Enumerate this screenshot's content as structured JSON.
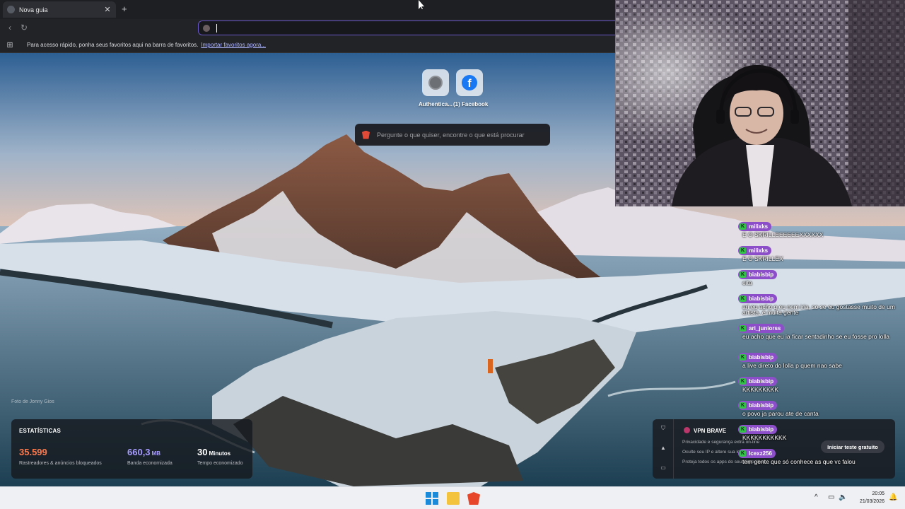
{
  "browser": {
    "tab": {
      "title": "Nova guia",
      "close_icon": "close-icon",
      "new_tab_icon": "plus-icon"
    },
    "toolbar": {
      "back_icon": "chevron-left-icon",
      "reload_icon": "reload-icon",
      "url_value": ""
    },
    "bookmarks": {
      "apps_icon": "apps-grid-icon",
      "hint": "Para acesso rápido, ponha seus favoritos aqui na barra de favoritos.",
      "import_link": "Importar favoritos agora..."
    }
  },
  "new_tab": {
    "top_sites": [
      {
        "label": "Authentica...",
        "icon": "globe-icon"
      },
      {
        "label": "(1) Facebook",
        "icon": "facebook-icon"
      }
    ],
    "search_placeholder": "Pergunte o que quiser, encontre o que está procurar",
    "photo_credit": "Foto de Jonny Gios",
    "stats": {
      "title": "ESTATÍSTICAS",
      "items": [
        {
          "value": "35.599",
          "unit": "",
          "label": "Rastreadores & anúncios bloqueados",
          "color": "#ff7a4d"
        },
        {
          "value": "660,3",
          "unit": "MB",
          "label": "Banda economizada",
          "color": "#a79cff"
        },
        {
          "value": "30",
          "unit": "Minutos",
          "label": "Tempo economizado",
          "color": "#ffffff"
        }
      ]
    },
    "vpn": {
      "title": "VPN BRAVE",
      "items": [
        "Privacidade e segurança extra on-line",
        "Oculte seu IP e altere sua localização",
        "Proteja todos os apps do seu dispositivo"
      ],
      "cta": "Iniciar teste gratuito"
    }
  },
  "chat": {
    "messages": [
      {
        "user": "milixks",
        "text": "E O SKRILLEEEEEEXXXXXX"
      },
      {
        "user": "milixks",
        "text": "E O SKRILLEX"
      },
      {
        "user": "biabisbip",
        "text": "eita"
      },
      {
        "user": "biabisbip",
        "text": "ari eu acho q eu nem iria, so se eu gostasse muito de um artista, é muita gente"
      },
      {
        "user": "ari_juniorss",
        "text": "eu acho que eu ia ficar sentadinho se eu fosse pro lolla"
      },
      {
        "user": "biabisbip",
        "text": "a live direto do lolla p quem nao sabe"
      },
      {
        "user": "biabisbip",
        "text": "KKKKKKKKK"
      },
      {
        "user": "biabisbip",
        "text": "o povo ja parou ate de canta"
      },
      {
        "user": "biabisbip",
        "text": "KKKKKKKKKKK"
      },
      {
        "user": "lcexz256",
        "text": "tem gente que só conhece as que vc falou"
      }
    ]
  },
  "taskbar": {
    "time": "20:05",
    "date": "21/03/2026",
    "icons": [
      "windows-start-icon",
      "file-explorer-icon",
      "brave-browser-icon"
    ],
    "tray": {
      "chevron": "^",
      "network": "▭",
      "volume": "🔈",
      "notify": "🔔"
    }
  },
  "colors": {
    "url_focus": "#6a57c9",
    "chat_badge": "#8c4fc9",
    "chat_mod": "#35c24a"
  }
}
